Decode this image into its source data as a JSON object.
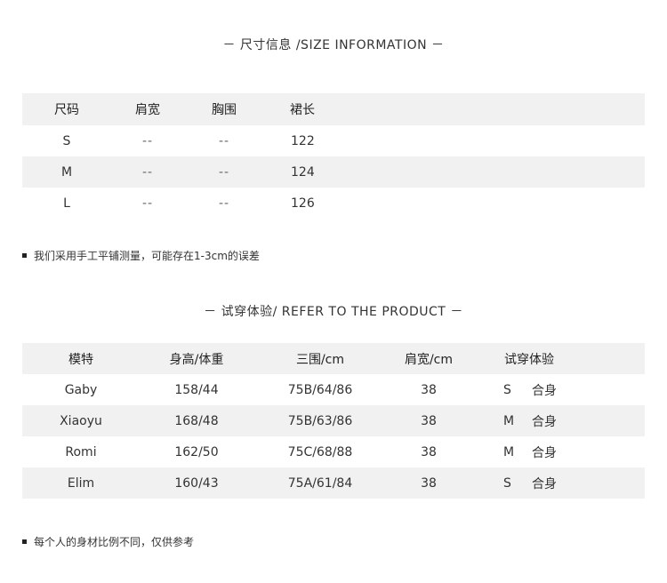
{
  "size_section": {
    "title": "－ 尺寸信息 /SIZE INFORMATION －",
    "headers": [
      "尺码",
      "肩宽",
      "胸围",
      "裙长"
    ],
    "rows": [
      [
        "S",
        "--",
        "--",
        "122"
      ],
      [
        "M",
        "--",
        "--",
        "124"
      ],
      [
        "L",
        "--",
        "--",
        "126"
      ]
    ],
    "note": "我们采用手工平铺测量，可能存在1-3cm的误差"
  },
  "fit_section": {
    "title": "－ 试穿体验/ REFER TO THE PRODUCT －",
    "headers": [
      "模特",
      "身高/体重",
      "三围/cm",
      "肩宽/cm",
      "试穿体验"
    ],
    "rows": [
      [
        "Gaby",
        "158/44",
        "75B/64/86",
        "38",
        "S",
        "合身"
      ],
      [
        "Xiaoyu",
        "168/48",
        "75B/63/86",
        "38",
        "M",
        "合身"
      ],
      [
        "Romi",
        "162/50",
        "75C/68/88",
        "38",
        "M",
        "合身"
      ],
      [
        "Elim",
        "160/43",
        "75A/61/84",
        "38",
        "S",
        "合身"
      ]
    ],
    "note": "每个人的身材比例不同，仅供参考"
  },
  "colors": {
    "row_shade": "#f1f1f1",
    "text": "#333333"
  }
}
